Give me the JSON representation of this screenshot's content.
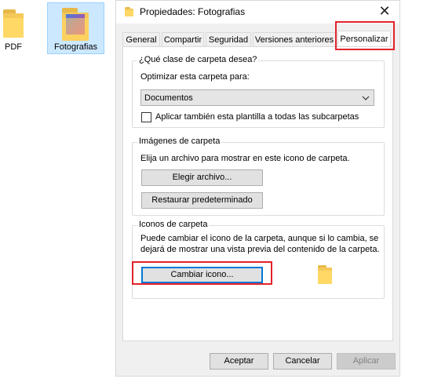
{
  "desktop": {
    "icons": [
      {
        "label": "PDF"
      },
      {
        "label": "Fotografias"
      }
    ]
  },
  "dialog": {
    "title": "Propiedades: Fotografias",
    "tabs": [
      {
        "label": "General"
      },
      {
        "label": "Compartir"
      },
      {
        "label": "Seguridad"
      },
      {
        "label": "Versiones anteriores"
      },
      {
        "label": "Personalizar"
      }
    ],
    "active_tab": "Personalizar",
    "folder_type": {
      "group_title": "¿Qué clase de carpeta desea?",
      "optimize_label": "Optimizar esta carpeta para:",
      "selected_value": "Documentos",
      "apply_sub_label": "Aplicar también esta plantilla a todas las subcarpetas",
      "apply_sub_checked": false
    },
    "folder_pictures": {
      "group_title": "Imágenes de carpeta",
      "description": "Elija un archivo para mostrar en este icono de carpeta.",
      "choose_file_label": "Elegir archivo...",
      "restore_default_label": "Restaurar predeterminado"
    },
    "folder_icons": {
      "group_title": "Iconos de carpeta",
      "description_line1": "Puede cambiar el icono de la carpeta, aunque si lo cambia, se",
      "description_line2": "dejará de mostrar una vista previa del contenido de la carpeta.",
      "change_icon_label": "Cambiar icono..."
    },
    "footer": {
      "accept_label": "Aceptar",
      "cancel_label": "Cancelar",
      "apply_label": "Aplicar"
    }
  },
  "highlight_color": "#e3222b",
  "accent_color": "#0078d7"
}
